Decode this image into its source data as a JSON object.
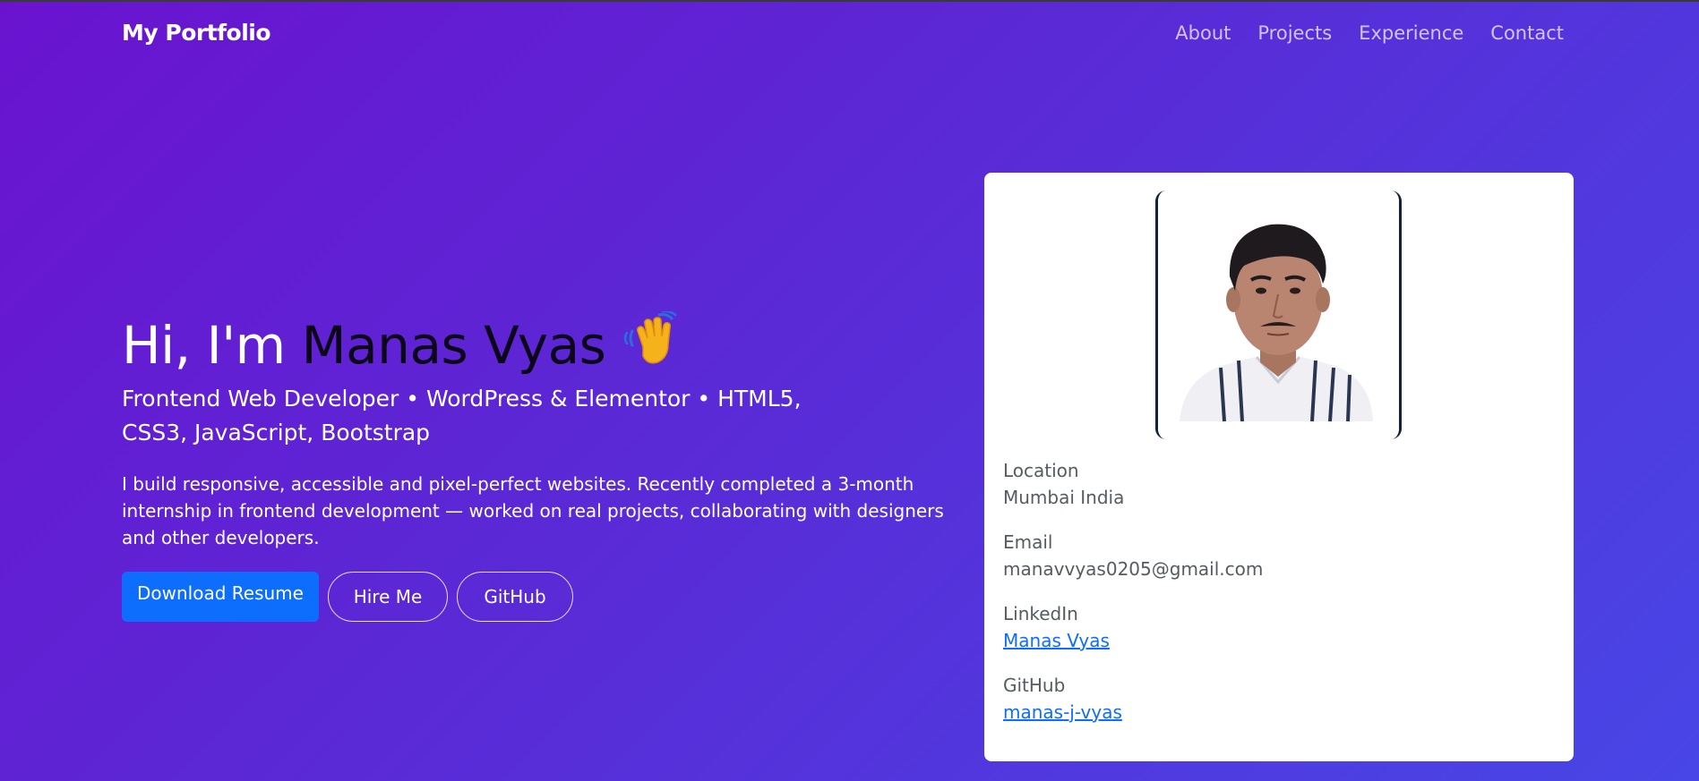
{
  "nav": {
    "brand": "My Portfolio",
    "links": [
      "About",
      "Projects",
      "Experience",
      "Contact"
    ]
  },
  "hero": {
    "greeting": "Hi, I'm ",
    "name": "Manas Vyas",
    "wave_icon": "waving-hand-icon",
    "subtitle": "Frontend Web Developer • WordPress & Elementor • HTML5, CSS3, JavaScript, Bootstrap",
    "description": "I build responsive, accessible and pixel-perfect websites. Recently completed a 3-month internship in frontend development — worked on real projects, collaborating with designers and other developers.",
    "buttons": {
      "resume": "Download Resume",
      "hire": "Hire Me",
      "github": "GitHub"
    }
  },
  "profile_card": {
    "photo_icon": "profile-photo",
    "location_label": "Location",
    "location_value": "Mumbai India",
    "email_label": "Email",
    "email_value": "manavvyas0205@gmail.com",
    "linkedin_label": "LinkedIn",
    "linkedin_value": "Manas Vyas",
    "github_label": "GitHub",
    "github_value": "manas-j-vyas"
  },
  "colors": {
    "gradient_start": "#6a13cf",
    "gradient_end": "#4846e6",
    "primary_button": "#0d6efd",
    "link": "#0d6efd",
    "name_text": "#0b0618"
  }
}
